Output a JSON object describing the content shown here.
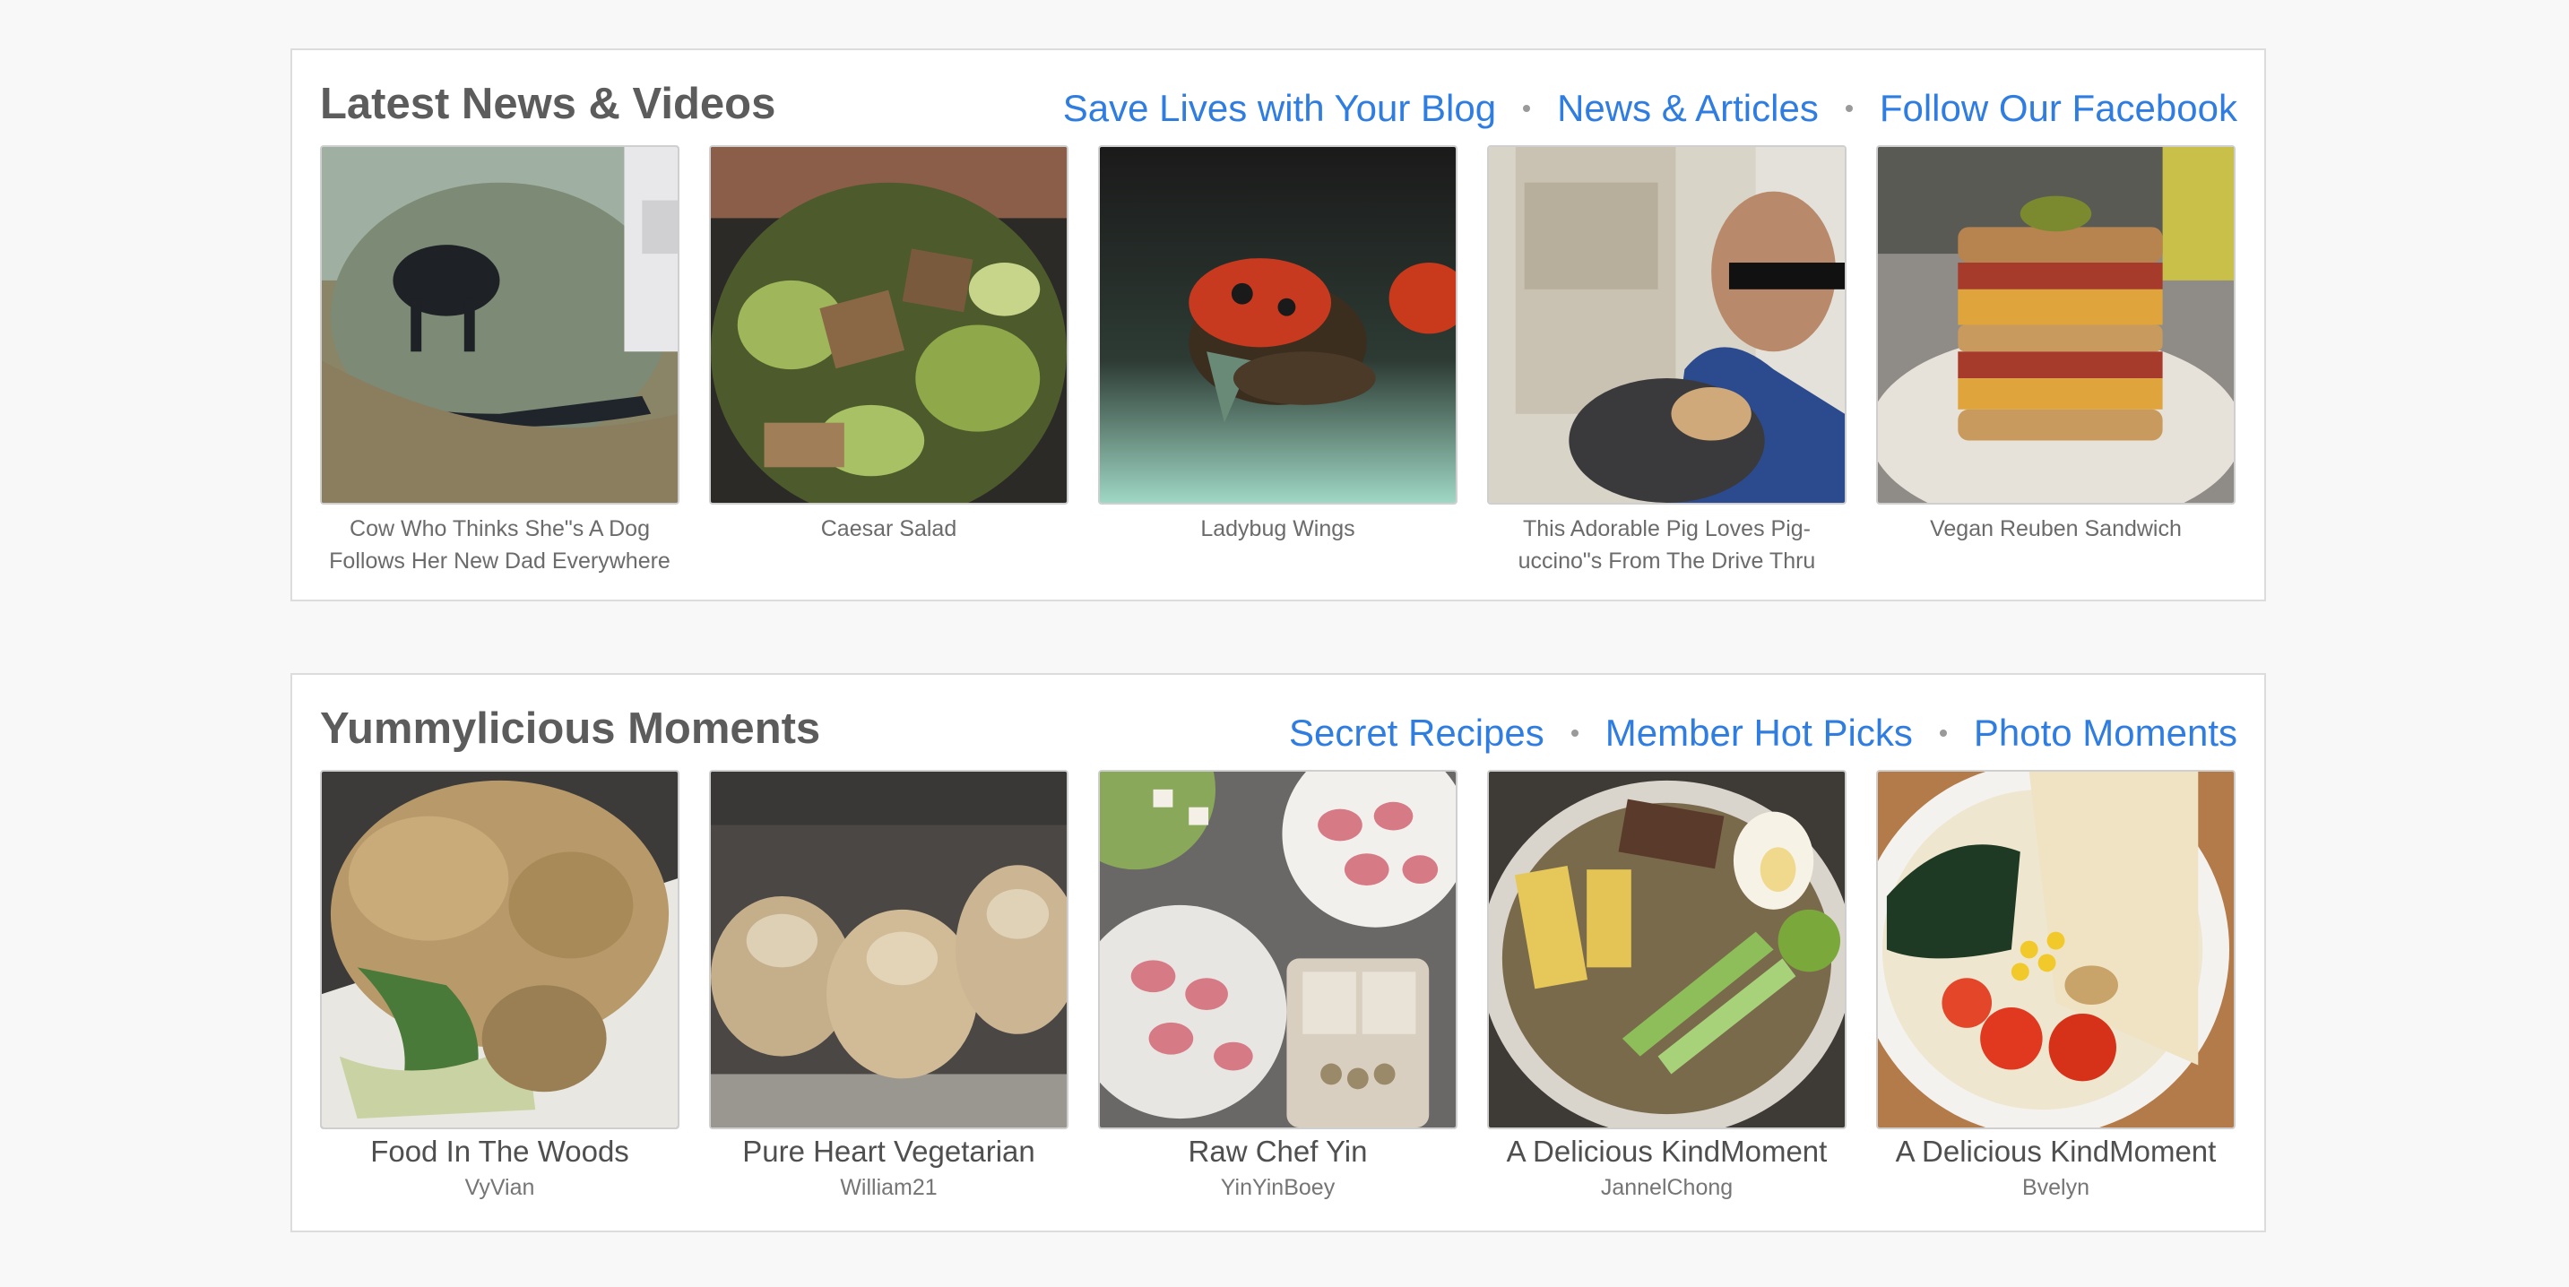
{
  "news": {
    "title": "Latest News & Videos",
    "links": [
      "Save Lives with Your Blog",
      "News & Articles",
      "Follow Our Facebook"
    ],
    "items": [
      {
        "caption": "Cow Who Thinks She\"s A Dog Follows Her New Dad Everywhere"
      },
      {
        "caption": "Caesar Salad"
      },
      {
        "caption": "Ladybug Wings"
      },
      {
        "caption": "This Adorable Pig Loves Pig-uccino\"s From The Drive Thru"
      },
      {
        "caption": "Vegan Reuben Sandwich"
      }
    ]
  },
  "yummy": {
    "title": "Yummylicious Moments",
    "links": [
      "Secret Recipes",
      "Member Hot Picks",
      "Photo Moments"
    ],
    "items": [
      {
        "title": "Food In The Woods",
        "user": "VyVian"
      },
      {
        "title": "Pure Heart Vegetarian",
        "user": "William21"
      },
      {
        "title": "Raw Chef Yin",
        "user": "YinYinBoey"
      },
      {
        "title": "A Delicious KindMoment",
        "user": "JannelChong"
      },
      {
        "title": "A Delicious KindMoment",
        "user": "Bvelyn"
      }
    ]
  },
  "colors": {
    "link": "#2f7de1",
    "panel_border": "#dcdcdc",
    "title_text": "#5c5c5c"
  }
}
